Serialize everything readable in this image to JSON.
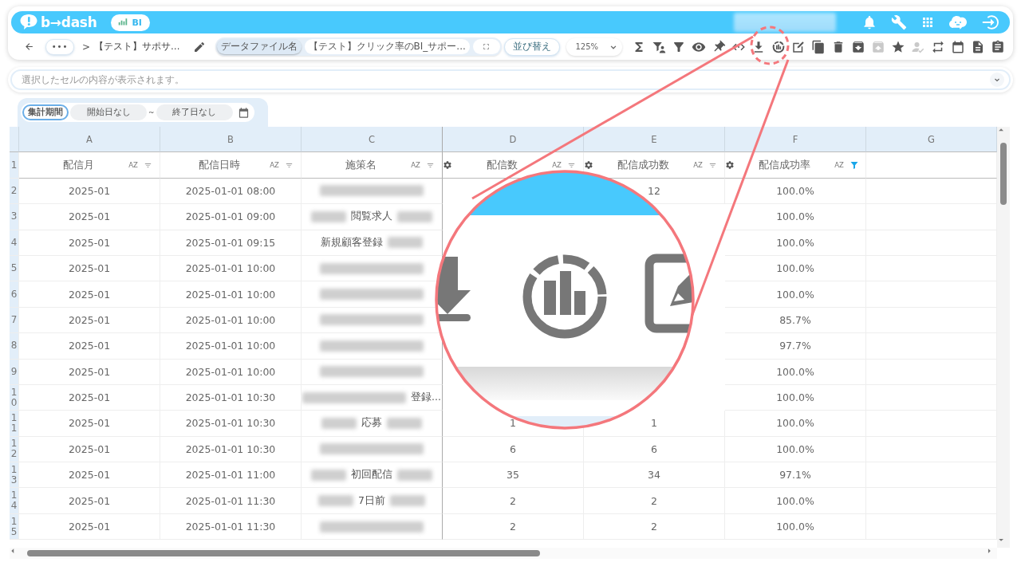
{
  "header": {
    "logo": "b→dash",
    "product_badge": "BI",
    "user": {
      "kind": "redacted"
    }
  },
  "toolbar": {
    "more": "•••",
    "separator": ">",
    "title": "【テスト】サポサ…",
    "file_chips": [
      {
        "label": "データファイル名",
        "selected": true
      },
      {
        "label": "【テスト】クリック率のBI_サポー...",
        "selected": false
      }
    ],
    "sort_button": "並び替え",
    "zoom": "125%",
    "tools": [
      {
        "kind": "sum",
        "disabled": false
      },
      {
        "kind": "filter_person",
        "disabled": false
      },
      {
        "kind": "filter",
        "disabled": false
      },
      {
        "kind": "eye",
        "disabled": false
      },
      {
        "kind": "pin",
        "disabled": false
      },
      {
        "kind": "code",
        "disabled": false
      },
      {
        "kind": "download",
        "disabled": false
      },
      {
        "kind": "chart",
        "disabled": false
      },
      {
        "kind": "edit",
        "disabled": false
      },
      {
        "kind": "copy",
        "disabled": false
      },
      {
        "kind": "trash",
        "disabled": false
      },
      {
        "kind": "archive_down",
        "disabled": false
      },
      {
        "kind": "archive_up",
        "disabled": true
      },
      {
        "kind": "star",
        "disabled": false
      },
      {
        "kind": "person_check",
        "disabled": true
      },
      {
        "kind": "swap",
        "disabled": false
      },
      {
        "kind": "calendar",
        "disabled": false
      },
      {
        "kind": "document",
        "disabled": false
      },
      {
        "kind": "clipboard",
        "disabled": false
      }
    ]
  },
  "cell_bar": {
    "placeholder": "選択したセルの内容が表示されます。"
  },
  "period_filter": {
    "label": "集計期間",
    "selected": true,
    "start": "開始日なし",
    "separator": "~",
    "end": "終了日なし"
  },
  "table": {
    "header_row_number": "1",
    "columns": [
      {
        "letter": "A",
        "header": "配信月",
        "sort": "AZ",
        "settings_icon": false,
        "filtered": false
      },
      {
        "letter": "B",
        "header": "配信日時",
        "sort": "AZ",
        "settings_icon": false,
        "filtered": false
      },
      {
        "letter": "C",
        "header": "施策名",
        "sort": "AZ",
        "settings_icon": false,
        "filtered": false
      },
      {
        "letter": "D",
        "header": "配信数",
        "sort": "AZ",
        "settings_icon": true,
        "filtered": false
      },
      {
        "letter": "E",
        "header": "配信成功数",
        "sort": "AZ",
        "settings_icon": true,
        "filtered": false
      },
      {
        "letter": "F",
        "header": "配信成功率",
        "sort": "AZ",
        "settings_icon": true,
        "filtered": true
      },
      {
        "letter": "G"
      }
    ],
    "rows": [
      {
        "number": "2",
        "cells": [
          {
            "text": "2025-01"
          },
          {
            "text": "2025-01-01 08:00"
          },
          {
            "segments": [
              {
                "kind": "redacted_long"
              }
            ]
          },
          {},
          {
            "text": "12"
          },
          {
            "text": "100.0%"
          }
        ]
      },
      {
        "number": "3",
        "cells": [
          {
            "text": "2025-01"
          },
          {
            "text": "2025-01-01 09:00"
          },
          {
            "segments": [
              {
                "kind": "redacted_short"
              },
              {
                "kind": "text",
                "text": "閲覧求人"
              },
              {
                "kind": "redacted_short"
              }
            ]
          },
          {},
          {},
          {
            "text": "100.0%"
          }
        ]
      },
      {
        "number": "4",
        "cells": [
          {
            "text": "2025-01"
          },
          {
            "text": "2025-01-01 09:15"
          },
          {
            "segments": [
              {
                "kind": "text",
                "text": "新規顧客登録"
              },
              {
                "kind": "redacted_short"
              }
            ]
          },
          {},
          {},
          {
            "text": "100.0%"
          }
        ]
      },
      {
        "number": "5",
        "cells": [
          {
            "text": "2025-01"
          },
          {
            "text": "2025-01-01 10:00"
          },
          {
            "segments": [
              {
                "kind": "redacted_long"
              }
            ]
          },
          {},
          {},
          {
            "text": "100.0%"
          }
        ]
      },
      {
        "number": "6",
        "cells": [
          {
            "text": "2025-01"
          },
          {
            "text": "2025-01-01 10:00"
          },
          {
            "segments": [
              {
                "kind": "redacted_long"
              }
            ]
          },
          {},
          {},
          {
            "text": "100.0%"
          }
        ]
      },
      {
        "number": "7",
        "cells": [
          {
            "text": "2025-01"
          },
          {
            "text": "2025-01-01 10:00"
          },
          {
            "segments": [
              {
                "kind": "redacted_long"
              }
            ]
          },
          {},
          {},
          {
            "text": "85.7%"
          }
        ]
      },
      {
        "number": "8",
        "cells": [
          {
            "text": "2025-01"
          },
          {
            "text": "2025-01-01 10:00"
          },
          {
            "segments": [
              {
                "kind": "redacted_long"
              }
            ]
          },
          {},
          {},
          {
            "text": "97.7%"
          }
        ]
      },
      {
        "number": "9",
        "cells": [
          {
            "text": "2025-01"
          },
          {
            "text": "2025-01-01 10:00"
          },
          {
            "segments": [
              {
                "kind": "redacted_long"
              }
            ]
          },
          {},
          {},
          {
            "text": "100.0%"
          }
        ]
      },
      {
        "number": "10",
        "cells": [
          {
            "text": "2025-01"
          },
          {
            "text": "2025-01-01 10:30"
          },
          {
            "segments": [
              {
                "kind": "redacted_long"
              },
              {
                "kind": "text",
                "text": "登録..."
              }
            ]
          },
          {},
          {},
          {
            "text": "100.0%"
          }
        ]
      },
      {
        "number": "11",
        "cells": [
          {
            "text": "2025-01"
          },
          {
            "text": "2025-01-01 10:30"
          },
          {
            "segments": [
              {
                "kind": "redacted_short"
              },
              {
                "kind": "text",
                "text": "応募"
              },
              {
                "kind": "redacted_short"
              }
            ]
          },
          {
            "text": "1"
          },
          {
            "text": "1"
          },
          {
            "text": "100.0%"
          }
        ]
      },
      {
        "number": "12",
        "cells": [
          {
            "text": "2025-01"
          },
          {
            "text": "2025-01-01 10:30"
          },
          {
            "segments": [
              {
                "kind": "redacted_long"
              }
            ]
          },
          {
            "text": "6"
          },
          {
            "text": "6"
          },
          {
            "text": "100.0%"
          }
        ]
      },
      {
        "number": "13",
        "cells": [
          {
            "text": "2025-01"
          },
          {
            "text": "2025-01-01 11:00"
          },
          {
            "segments": [
              {
                "kind": "redacted_short"
              },
              {
                "kind": "text",
                "text": "初回配信"
              },
              {
                "kind": "redacted_short"
              }
            ]
          },
          {
            "text": "35"
          },
          {
            "text": "34"
          },
          {
            "text": "97.1%"
          }
        ]
      },
      {
        "number": "14",
        "cells": [
          {
            "text": "2025-01"
          },
          {
            "text": "2025-01-01 11:30"
          },
          {
            "segments": [
              {
                "kind": "redacted_short"
              },
              {
                "kind": "text",
                "text": "7日前"
              },
              {
                "kind": "redacted_short"
              }
            ]
          },
          {
            "text": "2"
          },
          {
            "text": "2"
          },
          {
            "text": "100.0%"
          }
        ]
      },
      {
        "number": "15",
        "cells": [
          {
            "text": "2025-01"
          },
          {
            "text": "2025-01-01 11:30"
          },
          {
            "segments": [
              {
                "kind": "redacted_long"
              }
            ]
          },
          {
            "text": "2"
          },
          {
            "text": "2"
          },
          {
            "text": "100.0%"
          }
        ]
      }
    ]
  },
  "annotation": {
    "kind": "magnifier"
  }
}
